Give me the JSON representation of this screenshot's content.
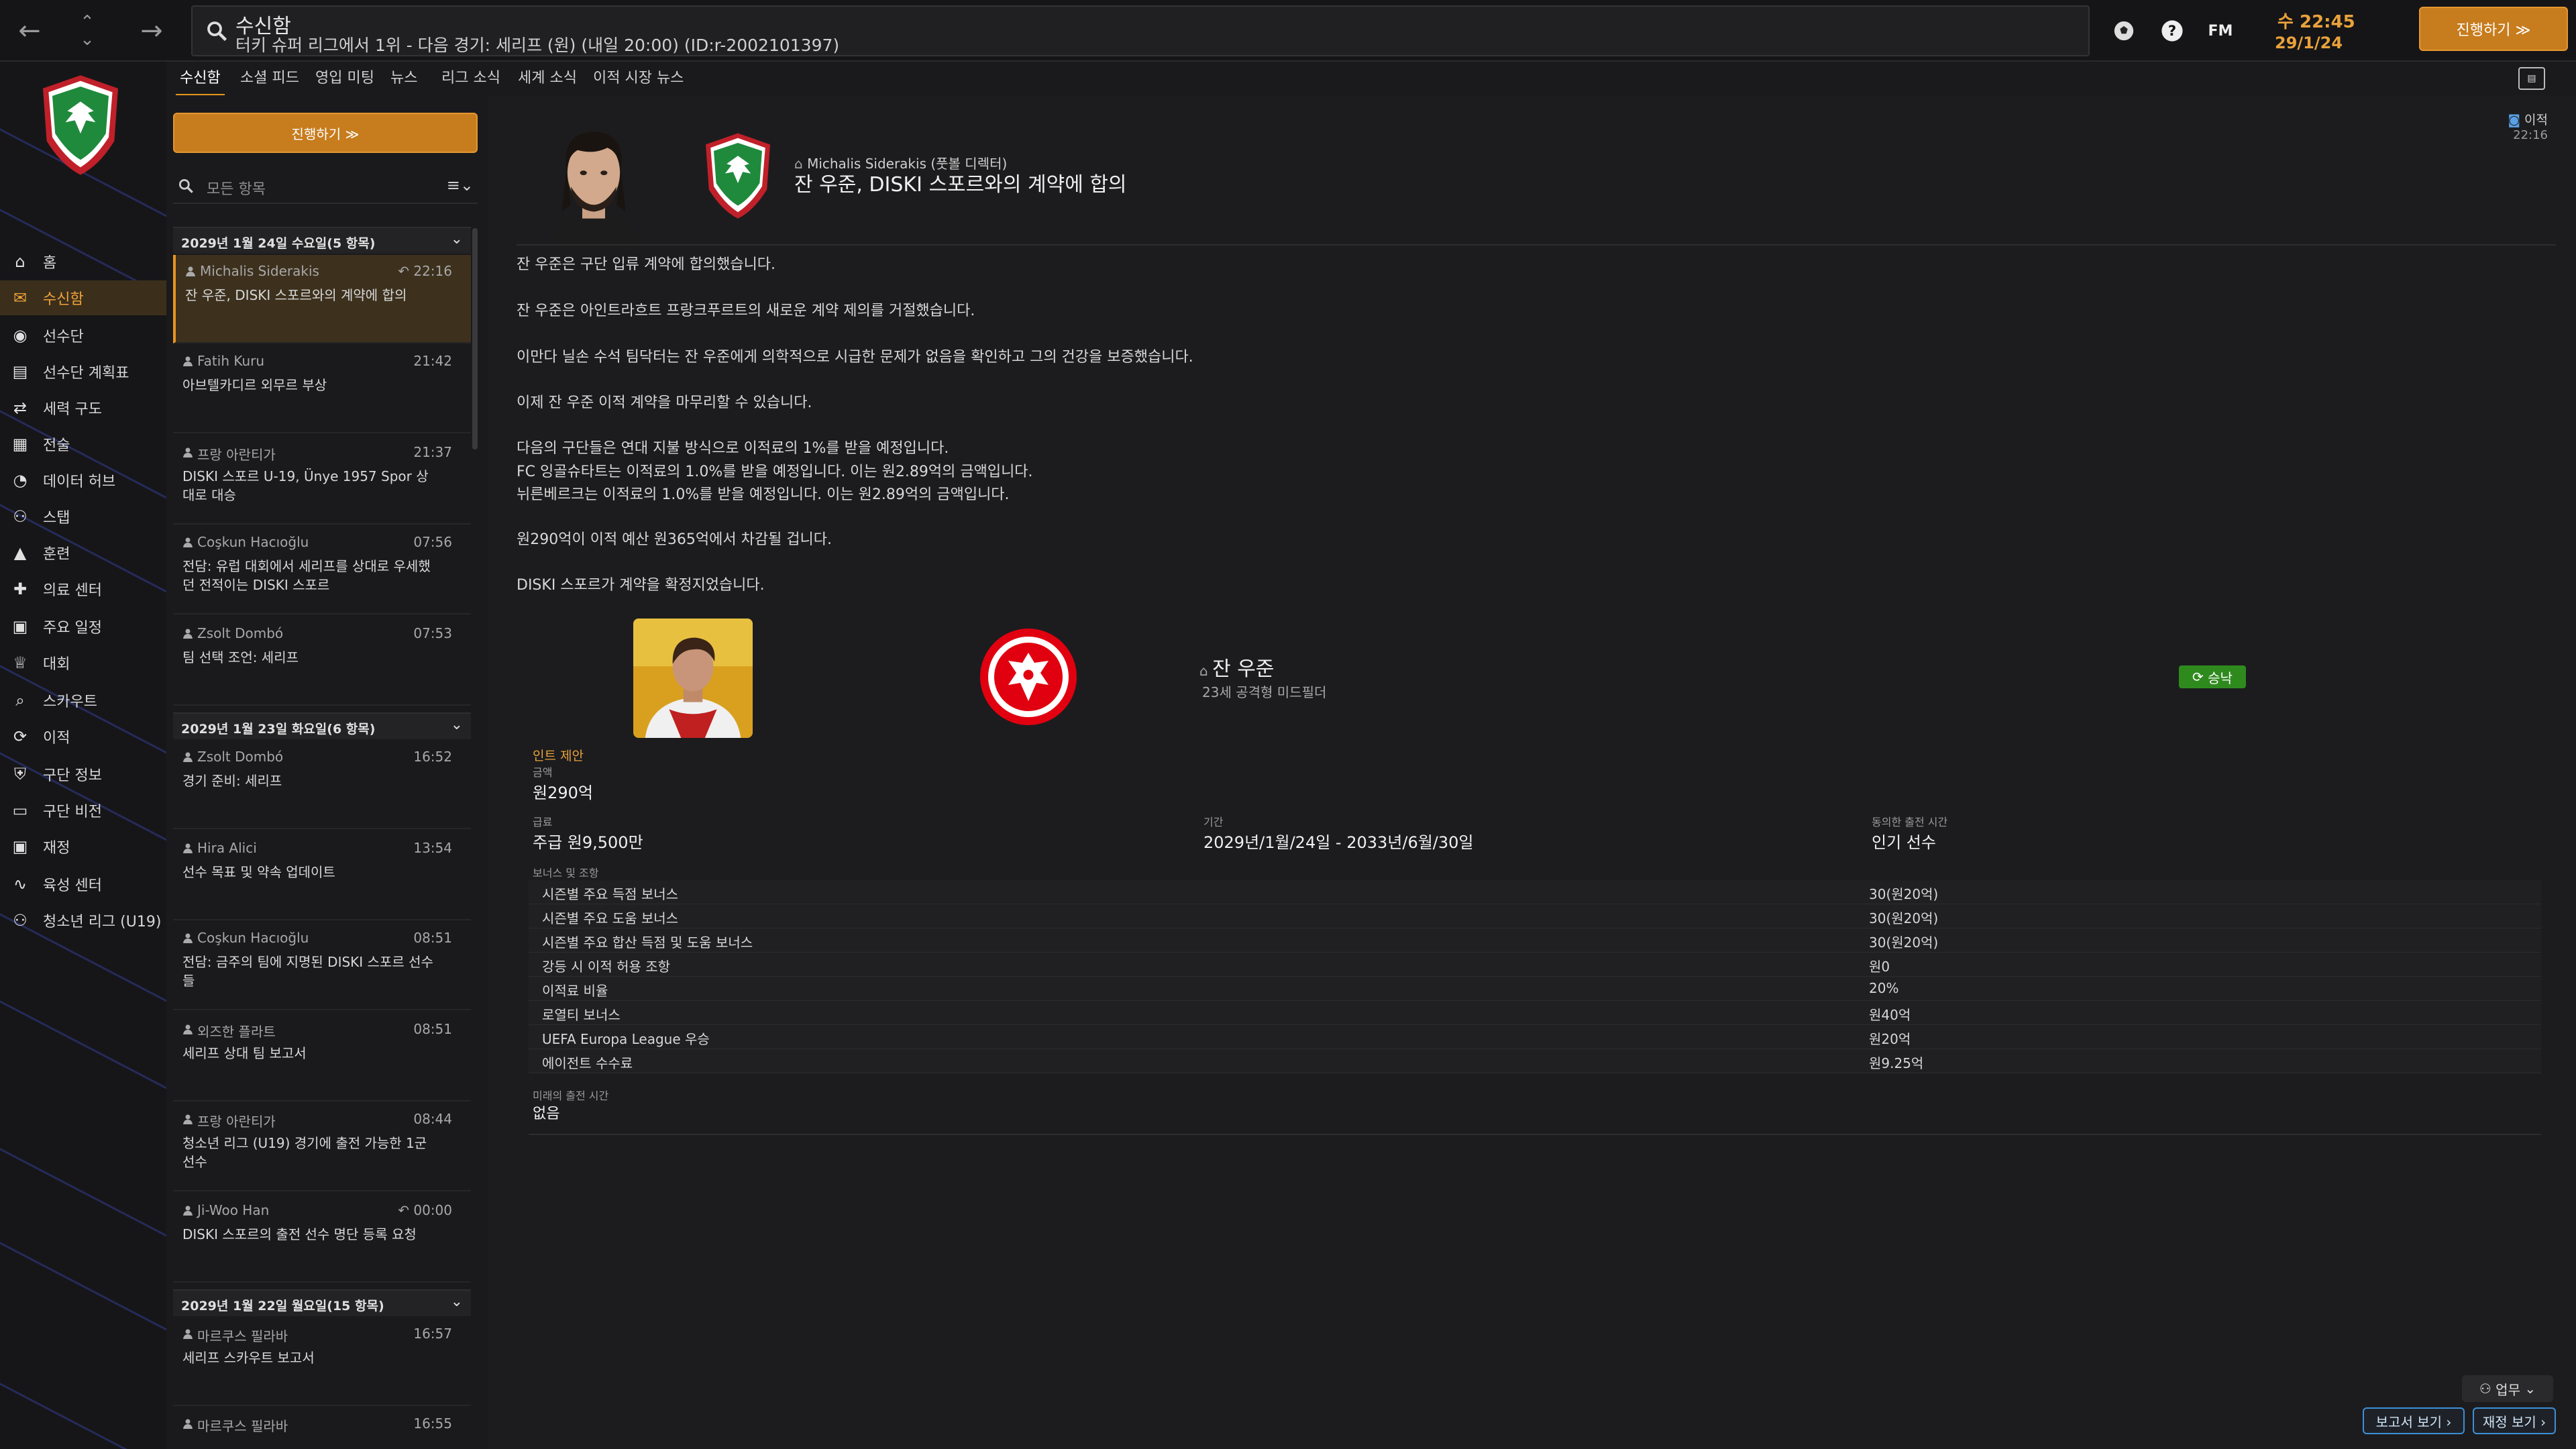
{
  "topbar": {
    "title": "수신함",
    "subtitle": "터키 슈퍼 리그에서 1위 - 다음 경기: 세리프 (원) (내일 20:00) (ID:r-2002101397)",
    "fm_label": "FM",
    "clock_time": "수 22:45",
    "clock_date": "29/1/24",
    "continue_label": "진행하기 ≫"
  },
  "sidebar": {
    "items": [
      {
        "label": "홈",
        "icon": "home-icon"
      },
      {
        "label": "수신함",
        "icon": "inbox-icon"
      },
      {
        "label": "선수단",
        "icon": "squad-icon"
      },
      {
        "label": "선수단 계획표",
        "icon": "planner-icon"
      },
      {
        "label": "세력 구도",
        "icon": "dynamics-icon"
      },
      {
        "label": "전술",
        "icon": "tactics-icon"
      },
      {
        "label": "데이터 허브",
        "icon": "data-hub-icon"
      },
      {
        "label": "스탭",
        "icon": "staff-icon"
      },
      {
        "label": "훈련",
        "icon": "training-icon"
      },
      {
        "label": "의료 센터",
        "icon": "medical-icon"
      },
      {
        "label": "주요 일정",
        "icon": "calendar-icon"
      },
      {
        "label": "대회",
        "icon": "trophy-icon"
      },
      {
        "label": "스카우트",
        "icon": "scout-icon"
      },
      {
        "label": "이적",
        "icon": "transfer-icon"
      },
      {
        "label": "구단 정보",
        "icon": "club-info-icon"
      },
      {
        "label": "구단 비전",
        "icon": "vision-icon"
      },
      {
        "label": "재정",
        "icon": "finance-icon"
      },
      {
        "label": "육성 센터",
        "icon": "development-icon"
      },
      {
        "label": "청소년 리그 (U19)",
        "icon": "youth-icon"
      }
    ]
  },
  "tabs": [
    "수신함",
    "소셜 피드",
    "영입 미팅",
    "뉴스",
    "리그 소식",
    "세계 소식",
    "이적 시장 뉴스"
  ],
  "list": {
    "continue_label": "진행하기 ≫",
    "filter_placeholder": "모든 항목",
    "groups": [
      {
        "title": "2029년 1월 24일 수요일(5 항목)"
      },
      {
        "title": "2029년 1월 23일 화요일(6 항목)"
      },
      {
        "title": "2029년 1월 22일 월요일(15 항목)"
      }
    ],
    "messages": [
      {
        "sender": "Michalis Siderakis",
        "time": "22:16",
        "subject": "잔 우준, DISKI 스포르와의 계약에 합의"
      },
      {
        "sender": "Fatih Kuru",
        "time": "21:42",
        "subject": "아브텔카디르 외무르 부상"
      },
      {
        "sender": "프랑 아란티가",
        "time": "21:37",
        "subject": "DISKI 스포르 U-19, Ünye 1957 Spor 상대로 대승"
      },
      {
        "sender": "Coşkun Hacıoğlu",
        "time": "07:56",
        "subject": "전담: 유럽 대회에서 세리프를 상대로 우세했던 전적이는 DISKI 스포르"
      },
      {
        "sender": "Zsolt Dombó",
        "time": "07:53",
        "subject": "팀 선택 조언: 세리프"
      },
      {
        "sender": "Zsolt Dombó",
        "time": "16:52",
        "subject": "경기 준비: 세리프"
      },
      {
        "sender": "Hira Alici",
        "time": "13:54",
        "subject": "선수 목표 및 약속 업데이트"
      },
      {
        "sender": "Coşkun Hacıoğlu",
        "time": "08:51",
        "subject": "전담: 금주의 팀에 지명된 DISKI 스포르 선수들"
      },
      {
        "sender": "외즈한 플라트",
        "time": "08:51",
        "subject": "세리프 상대 팀 보고서"
      },
      {
        "sender": "프랑 아란티가",
        "time": "08:44",
        "subject": "청소년 리그 (U19) 경기에 출전 가능한 1군 선수"
      },
      {
        "sender": "Ji-Woo Han",
        "time": "00:00",
        "subject": "DISKI 스포르의 출전 선수 명단 등록 요청"
      },
      {
        "sender": "마르쿠스 필라바",
        "time": "16:57",
        "subject": "세리프 스카우트 보고서"
      },
      {
        "sender": "마르쿠스 필라바",
        "time": "16:55",
        "subject": ""
      }
    ]
  },
  "main": {
    "from": "Michalis Siderakis (풋볼 디렉터)",
    "headline": "잔 우준, DISKI 스포르와의 계약에 합의",
    "tag": "이적",
    "tag_time": "22:16",
    "paragraphs": [
      "잔 우준은 구단 입류 계약에 합의했습니다.",
      "잔 우준은 아인트라흐트 프랑크푸르트의 새로운 계약 제의를 거절했습니다.",
      "이만다 닐손 수석 팀닥터는 잔 우준에게 의학적으로 시급한 문제가 없음을 확인하고 그의 건강을 보증했습니다.",
      "이제 잔 우준 이적 계약을 마무리할 수 있습니다.",
      "다음의 구단들은 연대 지불 방식으로 이적료의 1%를 받을 예정입니다.",
      "FC 잉골슈타트는 이적료의 1.0%를 받을 예정입니다. 이는 원2.89억의 금액입니다.",
      "뉘른베르크는 이적료의 1.0%를 받을 예정입니다. 이는 원2.89억의 금액입니다.",
      "원290억이 이적 예산 원365억에서 차감될 겁니다.",
      "DISKI 스포르가 계약을 확정지었습니다."
    ],
    "player_name": "잔 우준",
    "player_desc": "23세 공격형 미드필더",
    "status": "승낙",
    "clause_title": "인트 제안",
    "fee_label": "금액",
    "fee_value": "원290억",
    "wage_label": "급료",
    "wage_value": "주급 원9,500만",
    "period_label": "기간",
    "period_value": "2029년/1월/24일 - 2033년/6월/30일",
    "playing_time_label": "동의한 출전 시간",
    "playing_time_value": "인기 선수",
    "bonus_label": "보너스 및 조항",
    "bonuses": [
      {
        "label": "시즌별 주요 득점 보너스",
        "value": "30(원20억)"
      },
      {
        "label": "시즌별 주요 도움 보너스",
        "value": "30(원20억)"
      },
      {
        "label": "시즌별 주요 합산 득점 및 도움 보너스",
        "value": "30(원20억)"
      },
      {
        "label": "강등 시 이적 허용 조항",
        "value": "원0"
      },
      {
        "label": "이적료 비율",
        "value": "20%"
      },
      {
        "label": "로열티 보너스",
        "value": "원40억"
      },
      {
        "label": "UEFA Europa League 우승",
        "value": "원20억"
      },
      {
        "label": "에이전트 수수료",
        "value": "원9.25억"
      }
    ],
    "future_label": "미래의 출전 시간",
    "future_value": "없음"
  },
  "bottom": {
    "task_label": "업무",
    "report_label": "보고서 보기 ›",
    "finance_label": "재정 보기 ›"
  },
  "colors": {
    "accent": "#e6951f",
    "accept": "#2f8a1e",
    "link": "#3c8fd6"
  }
}
